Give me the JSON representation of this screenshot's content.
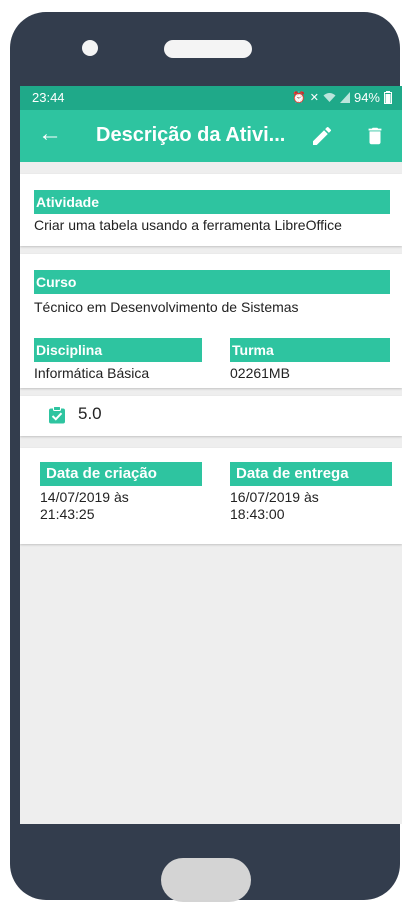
{
  "status": {
    "time": "23:44",
    "battery": "94%",
    "icons": [
      "alarm-icon",
      "mute-icon",
      "wifi-icon",
      "signal-icon",
      "battery-icon"
    ]
  },
  "appbar": {
    "title": "Descrição da Ativi...",
    "back_icon": "arrow-left-icon",
    "edit_icon": "pencil-icon",
    "delete_icon": "trash-icon"
  },
  "activity": {
    "label": "Atividade",
    "value": "Criar uma tabela usando a ferramenta LibreOffice"
  },
  "course": {
    "label": "Curso",
    "value": "Técnico em Desenvolvimento de Sistemas",
    "discipline_label": "Disciplina",
    "discipline_value": "Informática Básica",
    "class_label": "Turma",
    "class_value": "02261MB"
  },
  "grade": {
    "value": "5.0",
    "icon": "clipboard-check-icon"
  },
  "dates": {
    "created_label": "Data de criação",
    "created_date": "14/07/2019 às",
    "created_time": "21:43:25",
    "due_label": "Data de entrega",
    "due_date": "16/07/2019 às",
    "due_time": "18:43:00"
  },
  "colors": {
    "accent": "#2ec4a0",
    "status_bar": "#1fa989",
    "phone_body": "#333d4d"
  }
}
